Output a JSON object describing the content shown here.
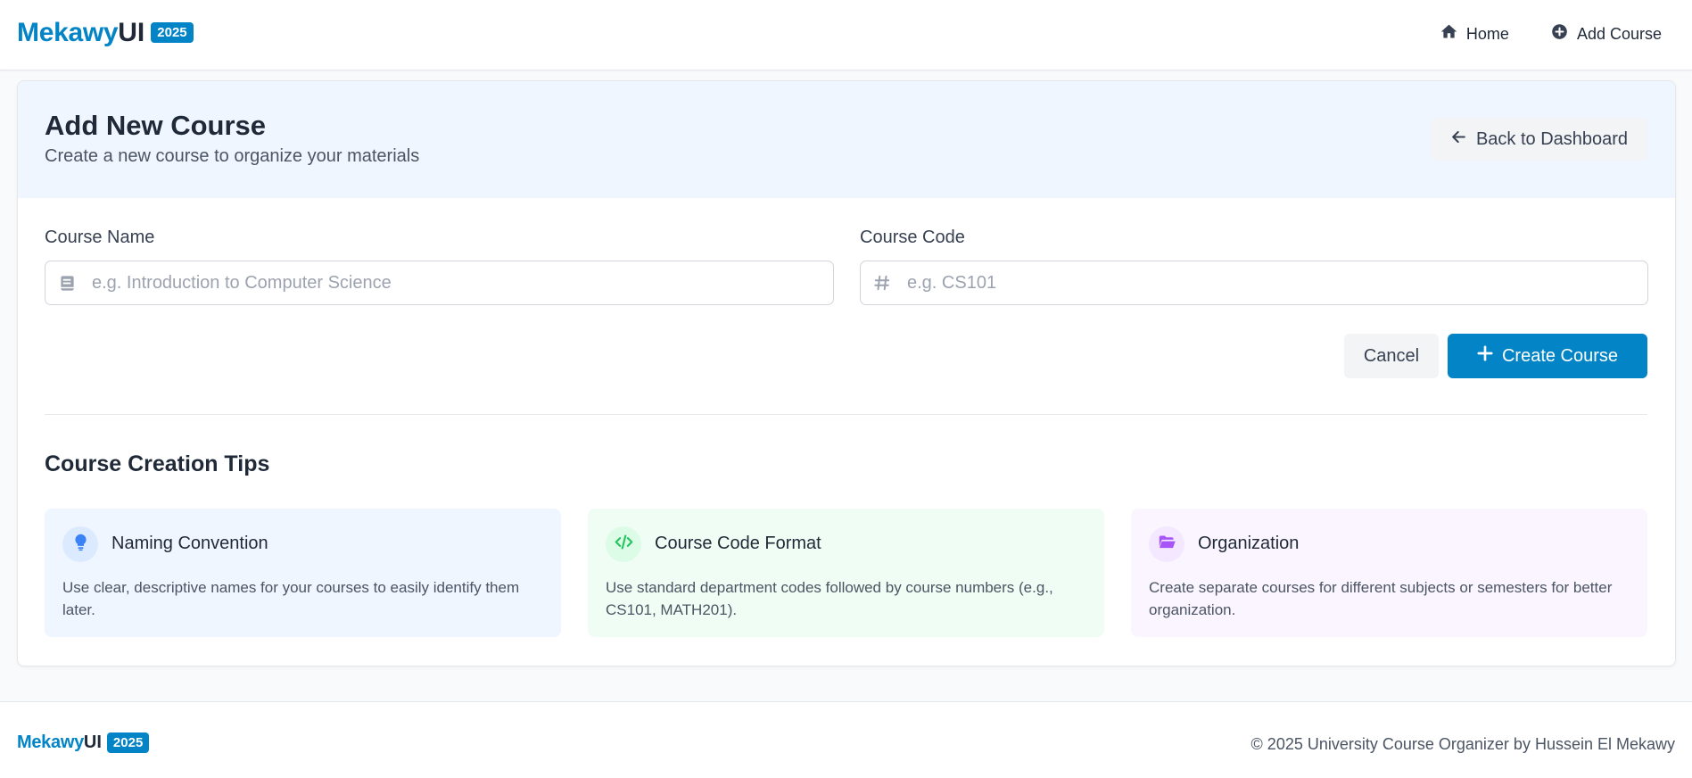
{
  "brand": {
    "name_main": "Mekawy",
    "name_ui": "UI",
    "badge": "2025"
  },
  "nav": {
    "home_label": "Home",
    "home_icon": "home-icon",
    "add_label": "Add Course",
    "add_icon": "plus-circle-icon"
  },
  "page": {
    "title": "Add New Course",
    "subtitle": "Create a new course to organize your materials",
    "back_label": "Back to Dashboard",
    "back_icon": "arrow-left-icon"
  },
  "form": {
    "course_name_label": "Course Name",
    "course_name_placeholder": "e.g. Introduction to Computer Science",
    "course_name_value": "",
    "course_name_icon": "book-icon",
    "course_code_label": "Course Code",
    "course_code_placeholder": "e.g. CS101",
    "course_code_value": "",
    "course_code_icon": "hash-icon",
    "cancel_label": "Cancel",
    "create_label": "Create Course",
    "create_icon": "plus-icon"
  },
  "tips": {
    "title": "Course Creation Tips",
    "items": [
      {
        "title": "Naming Convention",
        "text": "Use clear, descriptive names for your courses to easily identify them later.",
        "icon": "lightbulb-icon",
        "bg": "#eff6ff",
        "icon_bg": "#dbeafe",
        "icon_color": "#3b82f6"
      },
      {
        "title": "Course Code Format",
        "text": "Use standard department codes followed by course numbers (e.g., CS101, MATH201).",
        "icon": "code-icon",
        "bg": "#f0fdf4",
        "icon_bg": "#dcfce7",
        "icon_color": "#22c55e"
      },
      {
        "title": "Organization",
        "text": "Create separate courses for different subjects or semesters for better organization.",
        "icon": "folder-open-icon",
        "bg": "#faf5ff",
        "icon_bg": "#f3e8ff",
        "icon_color": "#a855f7"
      }
    ]
  },
  "footer": {
    "brand_main": "Mekawy",
    "brand_ui": "UI",
    "badge": "2025",
    "copyright": "© 2025 University Course Organizer by Hussein El Mekawy"
  },
  "colors": {
    "accent": "#0284c7",
    "header_bg": "#eff6ff",
    "page_bg": "#f9fafb"
  }
}
